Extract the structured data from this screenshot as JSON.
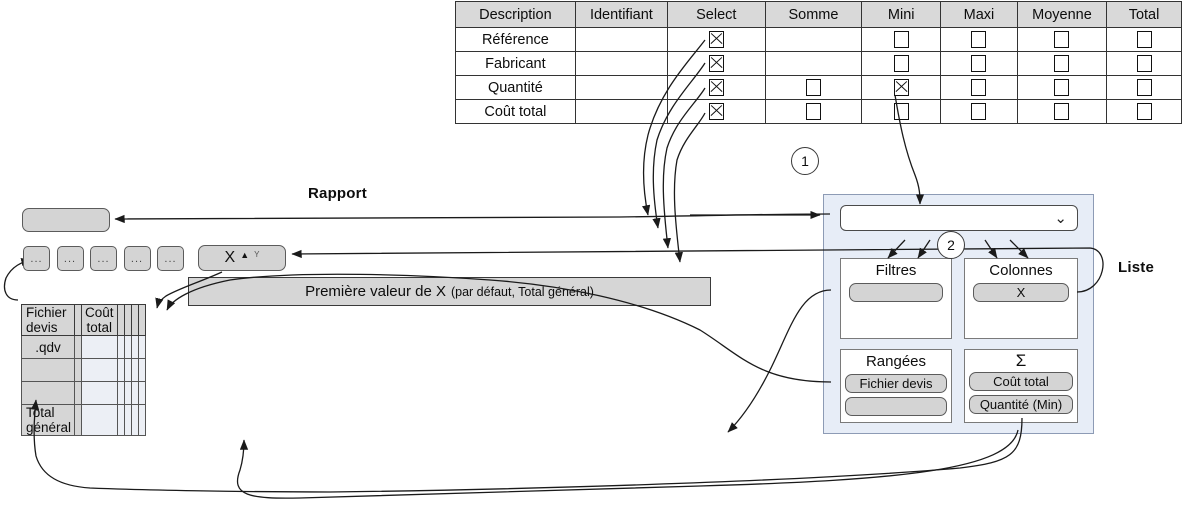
{
  "matrix": {
    "name": "attribute-selection-matrix",
    "headers": [
      "Description",
      "Identifiant",
      "Select",
      "Somme",
      "Mini",
      "Maxi",
      "Moyenne",
      "Total"
    ],
    "rows": [
      {
        "description": "Référence",
        "identifiant": "none",
        "select": "checked",
        "somme": "none",
        "mini": "unchecked",
        "maxi": "unchecked",
        "moyenne": "unchecked",
        "total": "unchecked"
      },
      {
        "description": "Fabricant",
        "identifiant": "none",
        "select": "checked",
        "somme": "none",
        "mini": "unchecked",
        "maxi": "unchecked",
        "moyenne": "unchecked",
        "total": "unchecked"
      },
      {
        "description": "Quantité",
        "identifiant": "none",
        "select": "checked",
        "somme": "unchecked",
        "mini": "checked",
        "maxi": "unchecked",
        "moyenne": "unchecked",
        "total": "unchecked"
      },
      {
        "description": "Coût total",
        "identifiant": "none",
        "select": "checked",
        "somme": "unchecked",
        "mini": "unchecked",
        "maxi": "unchecked",
        "moyenne": "unchecked",
        "total": "unchecked"
      }
    ]
  },
  "steps": {
    "one": "1",
    "two": "2"
  },
  "labels": {
    "rapport": "Rapport",
    "liste": "Liste"
  },
  "rapport": {
    "top_box": "",
    "small_buttons": [
      "...",
      "...",
      "...",
      "...",
      "..."
    ],
    "sort_button": {
      "x": "X",
      "triangle": "▲",
      "y": "Y"
    },
    "super_header": {
      "main": "Première valeur de X",
      "note": "(par défaut, Total général)"
    },
    "header_row": {
      "label": "Fichier devis",
      "blank": "",
      "c1": "Coût total",
      "c2": "",
      "c3": "",
      "c4": "",
      "c5": ""
    },
    "body_rows": [
      {
        "label": ".qdv",
        "blank": "",
        "c1": "",
        "c2": "",
        "c3": "",
        "c4": "",
        "c5": ""
      },
      {
        "label": "",
        "blank": "",
        "c1": "",
        "c2": "",
        "c3": "",
        "c4": "",
        "c5": ""
      },
      {
        "label": "",
        "blank": "",
        "c1": "",
        "c2": "",
        "c3": "",
        "c4": "",
        "c5": ""
      },
      {
        "label": "Total général",
        "blank": "",
        "c1": "",
        "c2": "",
        "c3": "",
        "c4": "",
        "c5": ""
      }
    ]
  },
  "panel": {
    "dropdown": {
      "value": "",
      "chevron": "⌄"
    },
    "zones": {
      "filtres": {
        "title": "Filtres",
        "chips": [
          ""
        ]
      },
      "colonnes": {
        "title": "Colonnes",
        "chips": [
          "X"
        ]
      },
      "rangees": {
        "title": "Rangées",
        "chips": [
          "Fichier devis",
          ""
        ]
      },
      "somme": {
        "title": "Σ",
        "chips": [
          "Coût total",
          "Quantité (Min)"
        ]
      }
    }
  },
  "colors": {
    "panel_bg": "#e7edf7",
    "panel_border": "#8d9bb5",
    "chip_bg": "#d4d4d4",
    "header_bg": "#d6d6d6",
    "data_cell_bg": "#eceff5",
    "line": "#1a1a1a"
  }
}
